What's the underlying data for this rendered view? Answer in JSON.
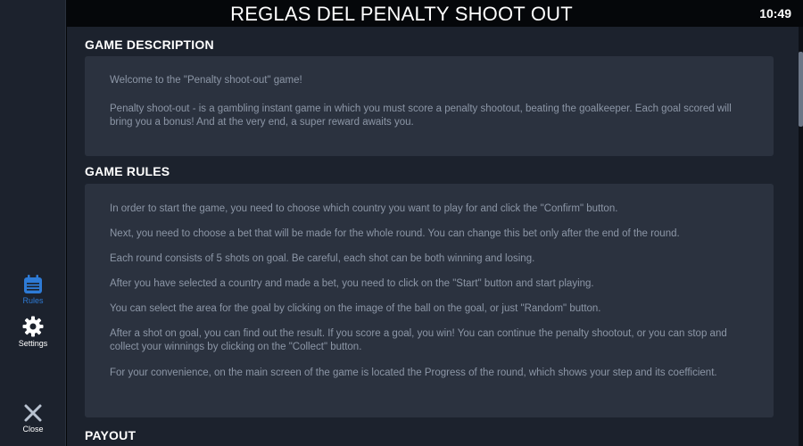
{
  "header": {
    "title": "REGLAS DEL PENALTY SHOOT OUT",
    "clock": "10:49"
  },
  "sidebar": {
    "items": [
      {
        "label": "Rules",
        "icon": "calendar-icon",
        "active": true
      },
      {
        "label": "Settings",
        "icon": "gear-icon"
      },
      {
        "label": "Close",
        "icon": "close-icon"
      }
    ]
  },
  "sections": {
    "description": {
      "title": "GAME DESCRIPTION",
      "paragraphs": [
        "Welcome to the \"Penalty shoot-out\" game!",
        "Penalty shoot-out - is a gambling instant game in which you must score a penalty shootout, beating the goalkeeper. Each goal scored will bring you a bonus! And at the very end, a super reward awaits you."
      ]
    },
    "rules": {
      "title": "GAME RULES",
      "paragraphs": [
        "In order to start the game, you need to choose which country you want to play for and click the \"Confirm\" button.",
        "Next, you need to choose a bet that will be made for the whole round. You can change this bet only after the end of the round.",
        "Each round consists of 5 shots on goal. Be careful, each shot can be both winning and losing.",
        "After you have selected a country and made a bet, you need to click on the \"Start\" button and start playing.",
        "You can select the area for the goal by clicking on the image of the ball on the goal, or just \"Random\" button.",
        "After a shot on goal, you can find out the result. If you score a goal, you win! You can continue the penalty shootout, or you can stop and collect your winnings by clicking on the \"Collect\" button.",
        "For your convenience, on the main screen of the game is located the Progress of the round, which shows your step and its coefficient."
      ]
    },
    "payout": {
      "title": "PAYOUT"
    }
  },
  "colors": {
    "background": "#05070a",
    "panel": "#2b323f",
    "sidebar": "#1c222d",
    "accent": "#2e7bd6"
  }
}
